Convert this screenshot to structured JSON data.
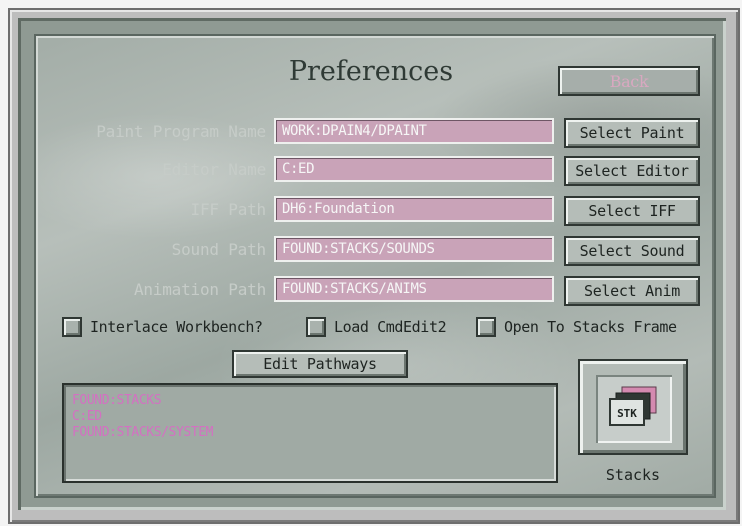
{
  "window": {
    "title": "Preferences"
  },
  "buttons": {
    "back": "Back",
    "select_paint": "Select Paint",
    "select_editor": "Select Editor",
    "select_iff": "Select IFF",
    "select_sound": "Select Sound",
    "select_anim": "Select Anim",
    "edit_pathways": "Edit Pathways"
  },
  "fields": [
    {
      "label": "Paint Program Name",
      "value": "WORK:DPAIN4/DPAINT"
    },
    {
      "label": "Editor Name",
      "value": "C:ED"
    },
    {
      "label": "IFF Path",
      "value": "DH6:Foundation"
    },
    {
      "label": "Sound Path",
      "value": "FOUND:STACKS/SOUNDS"
    },
    {
      "label": "Animation Path",
      "value": "FOUND:STACKS/ANIMS"
    }
  ],
  "checkboxes": {
    "interlace": "Interlace Workbench?",
    "load_cmdedit": "Load CmdEdit2",
    "open_stacks": "Open To Stacks Frame"
  },
  "pathways": [
    "FOUND:STACKS",
    "C:ED",
    "FOUND:STACKS/SYSTEM"
  ],
  "stacks": {
    "label": "Stacks",
    "icon_text": "STK"
  },
  "colors": {
    "field_bg": "#c9a3b8",
    "list_text": "#d470c2",
    "panel": "#a9b3ad"
  }
}
